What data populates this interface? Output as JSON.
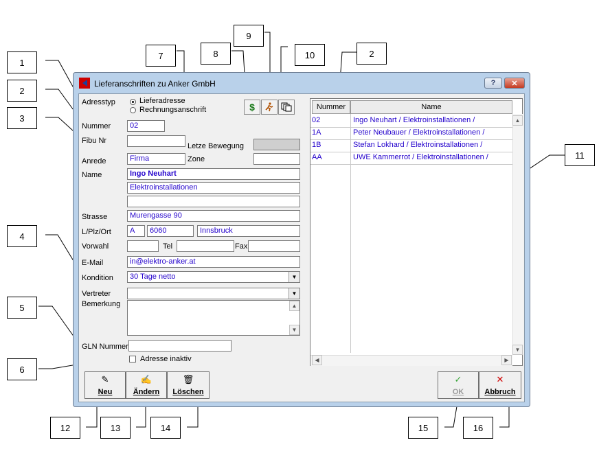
{
  "window": {
    "title": "Lieferanschriften zu Anker GmbH",
    "help_label": "?",
    "close_label": "✕"
  },
  "form": {
    "adresstyp_label": "Adresstyp",
    "adresstyp_options": [
      "Lieferadresse",
      "Rechnungsanschrift"
    ],
    "adresstyp_selected": "Lieferadresse",
    "nummer_label": "Nummer",
    "nummer_value": "02",
    "fibu_label": "Fibu Nr",
    "fibu_value": "",
    "letzte_bewegung_label": "Letze Bewegung",
    "zone_label": "Zone",
    "anrede_label": "Anrede",
    "anrede_value": "Firma",
    "name_label": "Name",
    "name_value": "Ingo Neuhart",
    "name2_value": "Elektroinstallationen",
    "name3_value": "",
    "strasse_label": "Strasse",
    "strasse_value": "Murengasse 90",
    "plz_label": "L/Plz/Ort",
    "land_value": "A",
    "plz_value": "6060",
    "ort_value": "Innsbruck",
    "vorwahl_label": "Vorwahl",
    "tel_label": "Tel",
    "fax_label": "Fax",
    "email_label": "E-Mail",
    "email_value": "in@elektro-anker.at",
    "kondition_label": "Kondition",
    "kondition_value": "30 Tage netto",
    "vertreter_label": "Vertreter",
    "bemerkung_label": "Bemerkung",
    "gln_label": "GLN Nummer",
    "inaktiv_label": "Adresse inaktiv"
  },
  "toolbar_icons": {
    "dollar": "dollar-icon",
    "runner": "running-person-icon",
    "copy": "copy-pages-icon"
  },
  "grid": {
    "columns": [
      "Nummer",
      "Name"
    ],
    "rows": [
      {
        "nummer": "02",
        "name": "Ingo Neuhart / Elektroinstallationen /"
      },
      {
        "nummer": "1A",
        "name": "Peter Neubauer / Elektroinstallationen /"
      },
      {
        "nummer": "1B",
        "name": "Stefan Lokhard / Elektroinstallationen /"
      },
      {
        "nummer": "AA",
        "name": "UWE Kammerrot / Elektroinstallationen /"
      }
    ]
  },
  "buttons": {
    "neu": "Neu",
    "aendern": "Ändern",
    "loeschen": "Löschen",
    "ok": "OK",
    "abbruch": "Abbruch"
  },
  "callouts": [
    "1",
    "2",
    "3",
    "4",
    "5",
    "6",
    "7",
    "8",
    "9",
    "10",
    "2",
    "11",
    "12",
    "13",
    "14",
    "15",
    "16"
  ],
  "colors": {
    "value_text": "#2200cc",
    "window_frame": "#b9d1ea",
    "ok_check": "#3aa63a",
    "abbruch_x": "#d00000"
  }
}
